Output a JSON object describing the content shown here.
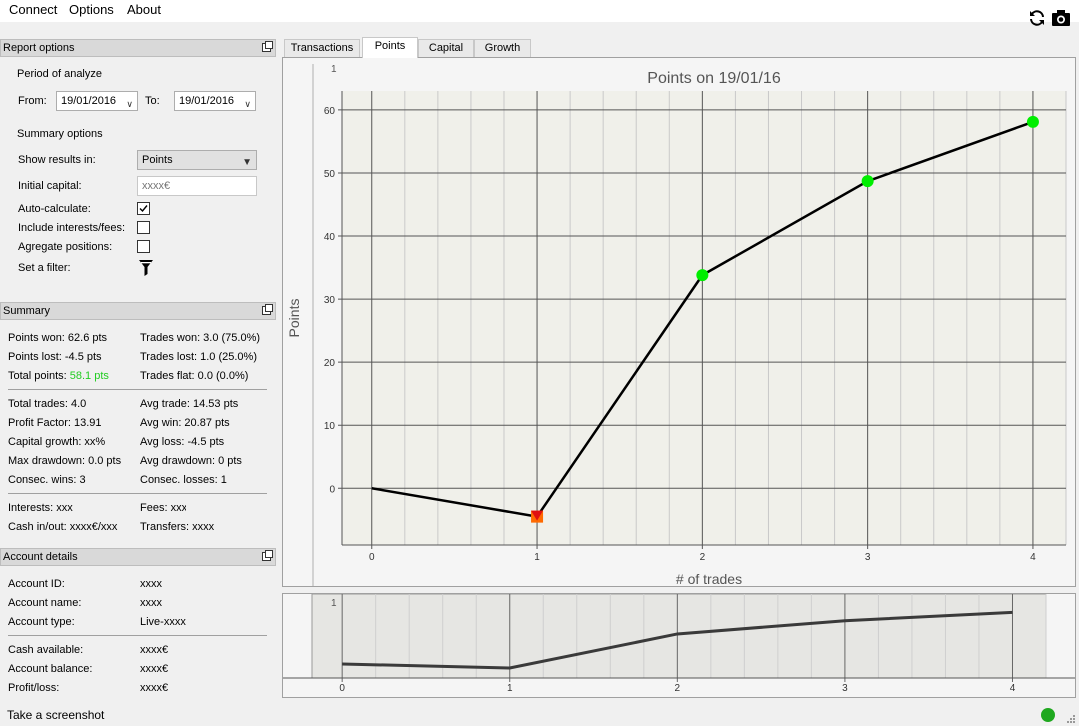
{
  "menu": {
    "items": [
      "Connect",
      "Options",
      "About"
    ]
  },
  "toolbar": {
    "refresh_icon": "refresh-icon",
    "camera_icon": "camera-icon"
  },
  "report_options": {
    "title": "Report options",
    "period_label": "Period of analyze",
    "from_label": "From:",
    "from_value": "19/01/2016",
    "to_label": "To:",
    "to_value": "19/01/2016",
    "summary_options_label": "Summary options",
    "show_results_label": "Show results in:",
    "show_results_value": "Points",
    "initial_capital_label": "Initial capital:",
    "initial_capital_placeholder": "xxxx€",
    "auto_calculate_label": "Auto-calculate:",
    "auto_calculate_checked": true,
    "interests_label": "Include interests/fees:",
    "interests_checked": false,
    "aggregate_label": "Agregate positions:",
    "aggregate_checked": false,
    "filter_label": "Set a filter:"
  },
  "summary": {
    "title": "Summary",
    "points_won": "Points won: 62.6 pts",
    "points_lost": "Points lost: -4.5 pts",
    "total_points_label": "Total points: ",
    "total_points_value": "58.1 pts",
    "trades_won": "Trades won: 3.0 (75.0%)",
    "trades_lost": "Trades lost: 1.0 (25.0%)",
    "trades_flat": "Trades flat: 0.0 (0.0%)",
    "total_trades": "Total trades: 4.0",
    "profit_factor": "Profit Factor: 13.91",
    "capital_growth": "Capital growth: xx%",
    "max_drawdown": "Max drawdown: 0.0 pts",
    "consec_wins": "Consec. wins: 3",
    "avg_trade": "Avg trade: 14.53 pts",
    "avg_win": "Avg win: 20.87 pts",
    "avg_loss": "Avg loss: -4.5 pts",
    "avg_drawdown": "Avg drawdown: 0 pts",
    "consec_losses": "Consec. losses: 1",
    "interests": "Interests: xxx",
    "fees": "Fees: xxx",
    "cash_inout": "Cash in/out: xxxx€/xxx",
    "transfers": "Transfers: xxxx"
  },
  "account": {
    "title": "Account details",
    "id_label": "Account ID:",
    "id_value": "xxxx",
    "name_label": "Account name:",
    "name_value": "xxxx",
    "type_label": "Account type:",
    "type_value": "Live-xxxx",
    "cash_label": "Cash available:",
    "cash_value": "xxxx€",
    "balance_label": "Account balance:",
    "balance_value": "xxxx€",
    "pl_label": "Profit/loss:",
    "pl_value": "xxxx€"
  },
  "tabs": [
    "Transactions",
    "Points",
    "Capital",
    "Growth"
  ],
  "active_tab": "Points",
  "status": {
    "message": "Take a screenshot",
    "indicator_color": "#1fa81f"
  },
  "colors": {
    "positive": "#22cc22",
    "win_marker": "#00ee00",
    "loss_marker_fill": "#ff6a00",
    "loss_marker_border": "#e01010"
  },
  "chart_data": {
    "type": "line",
    "title": "Points on 19/01/16",
    "xlabel": "# of trades",
    "ylabel": "Points",
    "x": [
      0,
      1,
      2,
      3,
      4
    ],
    "y": [
      0,
      -4.5,
      33.8,
      48.7,
      58.1
    ],
    "markers": [
      "none",
      "loss",
      "win",
      "win",
      "win"
    ],
    "xlim": [
      -0.18,
      4.2
    ],
    "ylim": [
      -9,
      63
    ],
    "xticks": [
      "0",
      "1",
      "2",
      "3",
      "4"
    ],
    "yticks": [
      "0",
      "10",
      "20",
      "30",
      "40",
      "50",
      "60"
    ],
    "grid": true,
    "corner_label": "1"
  },
  "overview_data": {
    "type": "line",
    "x": [
      0,
      1,
      2,
      3,
      4
    ],
    "y": [
      0,
      -4.5,
      33.8,
      48.7,
      58.1
    ],
    "xticks": [
      "0",
      "1",
      "2",
      "3",
      "4"
    ],
    "corner_label": "1"
  }
}
